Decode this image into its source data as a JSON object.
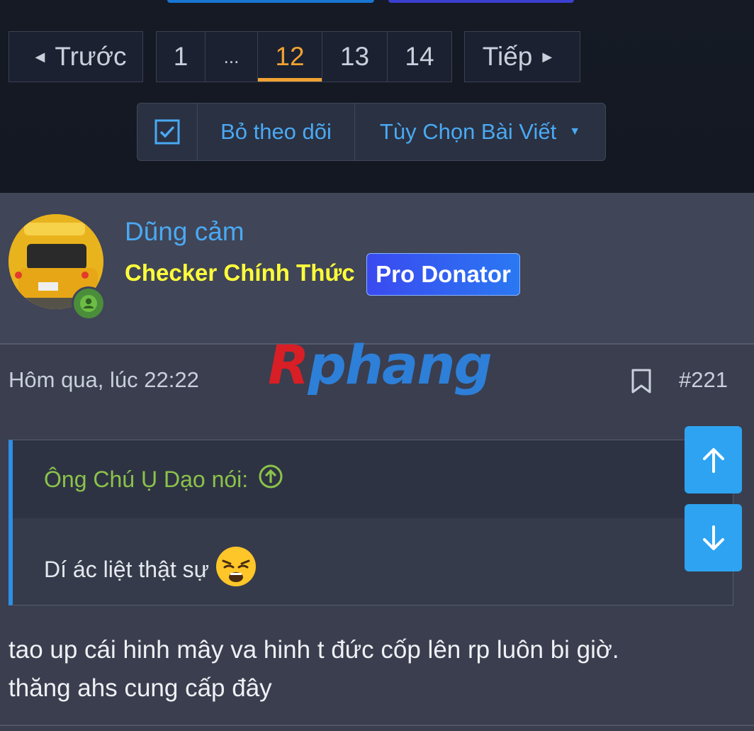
{
  "pagination": {
    "prev_label": "Trước",
    "next_label": "Tiếp",
    "pages": [
      "1",
      "...",
      "12",
      "13",
      "14"
    ],
    "current": "12"
  },
  "thread_actions": {
    "unwatch_label": "Bỏ theo dõi",
    "options_label": "Tùy Chọn Bài Viết"
  },
  "post": {
    "author": {
      "name": "Dũng cảm",
      "role": "Checker Chính Thức",
      "badge": "Pro Donator"
    },
    "date": "Hôm qua, lúc 22:22",
    "number": "#221",
    "watermark": "Rphang",
    "quote": {
      "attribution": "Ông Chú Ụ Dạo nói:",
      "text": "Dí ác liệt thật sự"
    },
    "body_line1": "tao up cái hinh mây va hinh t đức cốp lên rp luôn bi giờ.",
    "body_line2": "thăng ahs cung cấp đây"
  },
  "colors": {
    "accent_blue": "#4aa9f3",
    "current_page": "#f0a233",
    "role_yellow": "#ffff3a",
    "quote_green": "#8bc34a",
    "scroll_button": "#2ea3f2"
  },
  "icons": [
    "chevron-left-icon",
    "chevron-right-icon",
    "checkbox-icon",
    "caret-down-icon",
    "online-user-icon",
    "bookmark-icon",
    "arrow-up-circle-icon",
    "weary-face-emoji",
    "arrow-up-icon",
    "arrow-down-icon"
  ]
}
